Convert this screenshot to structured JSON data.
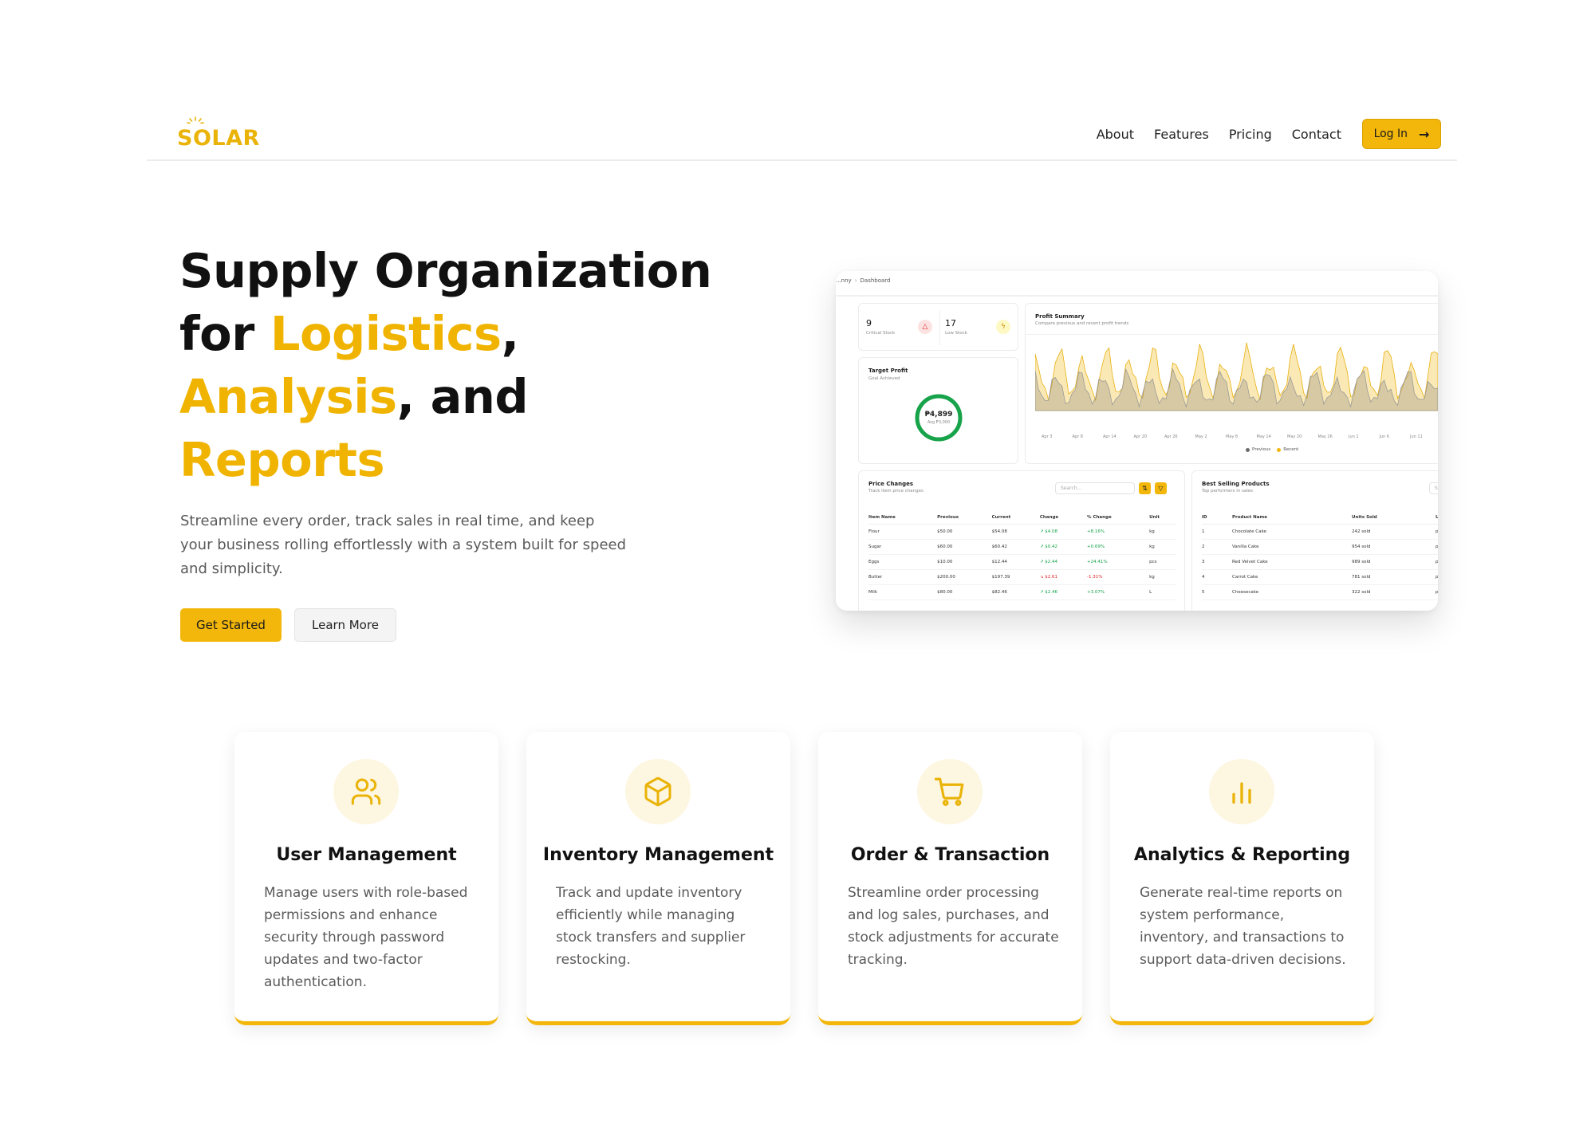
{
  "brand": {
    "logo_text": "SOLAR",
    "accent": "#f3b70b"
  },
  "nav": {
    "links": [
      "About",
      "Features",
      "Pricing",
      "Contact"
    ],
    "login_label": "Log In"
  },
  "hero": {
    "title_line1": "Supply Organization",
    "title_for": "for ",
    "title_logistics": "Logistics",
    "title_comma1": ",",
    "title_analysis": "Analysis",
    "title_and": ", and",
    "title_reports": "Reports",
    "description": "Streamline every order, track sales in real time, and keep your business rolling effortlessly with a system built for speed and simplicity.",
    "primary_button": "Get Started",
    "secondary_button": "Learn More"
  },
  "preview": {
    "breadcrumb_prev": "...nny",
    "breadcrumb_current": "Dashboard",
    "stats": [
      {
        "value": "9",
        "label": "Critical Stock",
        "icon": "alert-triangle-icon"
      },
      {
        "value": "17",
        "label": "Low Stock",
        "icon": "activity-icon"
      }
    ],
    "target_profit": {
      "title": "Target Profit",
      "subtitle": "Goal Achieved",
      "value": "₱4,899",
      "sub": "Avg ₱3,000",
      "progress": 1.0
    },
    "profit_summary": {
      "title": "Profit Summary",
      "subtitle": "Compare previous and recent profit trends",
      "x_ticks": [
        "Apr 3",
        "Apr 8",
        "Apr 14",
        "Apr 20",
        "Apr 26",
        "May 2",
        "May 8",
        "May 14",
        "May 20",
        "May 26",
        "Jun 1",
        "Jun 6",
        "Jun 11",
        "Jun"
      ],
      "legend": [
        {
          "name": "Previous",
          "color": "#6b6b6b"
        },
        {
          "name": "Recent",
          "color": "#f3b70b"
        }
      ]
    },
    "price_changes": {
      "title": "Price Changes",
      "subtitle": "Track item price changes",
      "search_placeholder": "Search...",
      "columns": [
        "Item Name",
        "Previous",
        "Current",
        "Change",
        "% Change",
        "Unit"
      ],
      "rows": [
        [
          "Flour",
          "$50.00",
          "$54.08",
          "↗ $4.08",
          "+8.16%",
          "kg"
        ],
        [
          "Sugar",
          "$60.00",
          "$60.42",
          "↗ $0.42",
          "+0.69%",
          "kg"
        ],
        [
          "Eggs",
          "$10.00",
          "$12.44",
          "↗ $2.44",
          "+24.41%",
          "pcs"
        ],
        [
          "Butter",
          "$200.00",
          "$197.39",
          "↘ $2.61",
          "-1.31%",
          "kg"
        ],
        [
          "Milk",
          "$80.00",
          "$82.46",
          "↗ $2.46",
          "+3.07%",
          "L"
        ]
      ]
    },
    "best_selling": {
      "title": "Best Selling Products",
      "subtitle": "Top performers in sales",
      "search_placeholder": "Sea",
      "columns": [
        "ID",
        "Product Name",
        "Units Sold",
        "U"
      ],
      "rows": [
        [
          "1",
          "Chocolate Cake",
          "242 sold",
          "p"
        ],
        [
          "2",
          "Vanilla Cake",
          "954 sold",
          "p"
        ],
        [
          "3",
          "Red Velvet Cake",
          "989 sold",
          "p"
        ],
        [
          "4",
          "Carrot Cake",
          "781 sold",
          "p"
        ],
        [
          "5",
          "Cheesecake",
          "322 sold",
          "p"
        ]
      ]
    }
  },
  "features": [
    {
      "icon": "users-icon",
      "title": "User Management",
      "description": "Manage users with role-based permissions and enhance security through password updates and two-factor authentication."
    },
    {
      "icon": "box-icon",
      "title": "Inventory Management",
      "description": "Track and update inventory efficiently while managing stock transfers and supplier restocking."
    },
    {
      "icon": "cart-icon",
      "title": "Order & Transaction",
      "description": "Streamline order processing and log sales, purchases, and stock adjustments for accurate tracking."
    },
    {
      "icon": "bar-chart-icon",
      "title": "Analytics & Reporting",
      "description": "Generate real-time reports on system performance, inventory, and transactions to support data-driven decisions."
    }
  ]
}
